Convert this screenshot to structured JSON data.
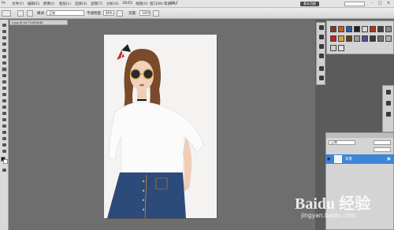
{
  "menu": {
    "items": [
      "文件(F)",
      "编辑(E)",
      "图像(I)",
      "图层(L)",
      "选择(S)",
      "滤镜(T)",
      "分析(A)",
      "3D(D)",
      "视图(V)",
      "窗口(W)",
      "帮助(H)"
    ],
    "zoom": "64.7",
    "workspace_label": "基本功能",
    "window_min": "-",
    "window_max": "□",
    "window_close": "×"
  },
  "options": {
    "mode_label": "模式:",
    "mode_value": "正常",
    "opacity_label": "不透明度:",
    "opacity_value": "89%",
    "flow_label": "流量:",
    "flow_value": "100%"
  },
  "document": {
    "tab_title": "9.jpg @ 64.7%(RGB/8)"
  },
  "layers": {
    "blend_value": "正常",
    "background_layer": "背景"
  },
  "colors": {
    "accent": "#3c85d8",
    "canvas": "#f4f3f2",
    "workspace": "#6e6e6e"
  },
  "watermark": {
    "text": "Baidu 经验",
    "url": "jingyan.baidu.com"
  }
}
